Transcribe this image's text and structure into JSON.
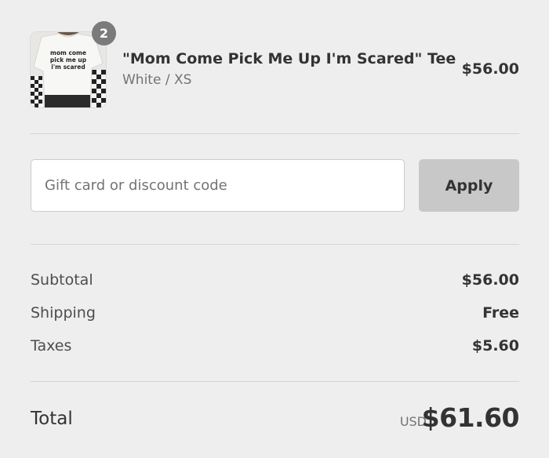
{
  "product": {
    "quantity": "2",
    "title": "\"Mom Come Pick Me Up I'm Scared\" Tee",
    "variant": "White / XS",
    "price": "$56.00",
    "image_text": [
      "mom come",
      "pick me up",
      "i'm scared"
    ]
  },
  "discount": {
    "placeholder": "Gift card or discount code",
    "value": "",
    "apply_label": "Apply"
  },
  "summary": {
    "subtotal_label": "Subtotal",
    "subtotal_value": "$56.00",
    "shipping_label": "Shipping",
    "shipping_value": "Free",
    "taxes_label": "Taxes",
    "taxes_value": "$5.60"
  },
  "total": {
    "label": "Total",
    "currency": "USD",
    "value": "$61.60"
  },
  "colors": {
    "background": "#eeeeee",
    "badge": "#7b7b7b",
    "apply_button": "#c8c8c8",
    "text": "#333333",
    "muted_text": "#737373"
  }
}
